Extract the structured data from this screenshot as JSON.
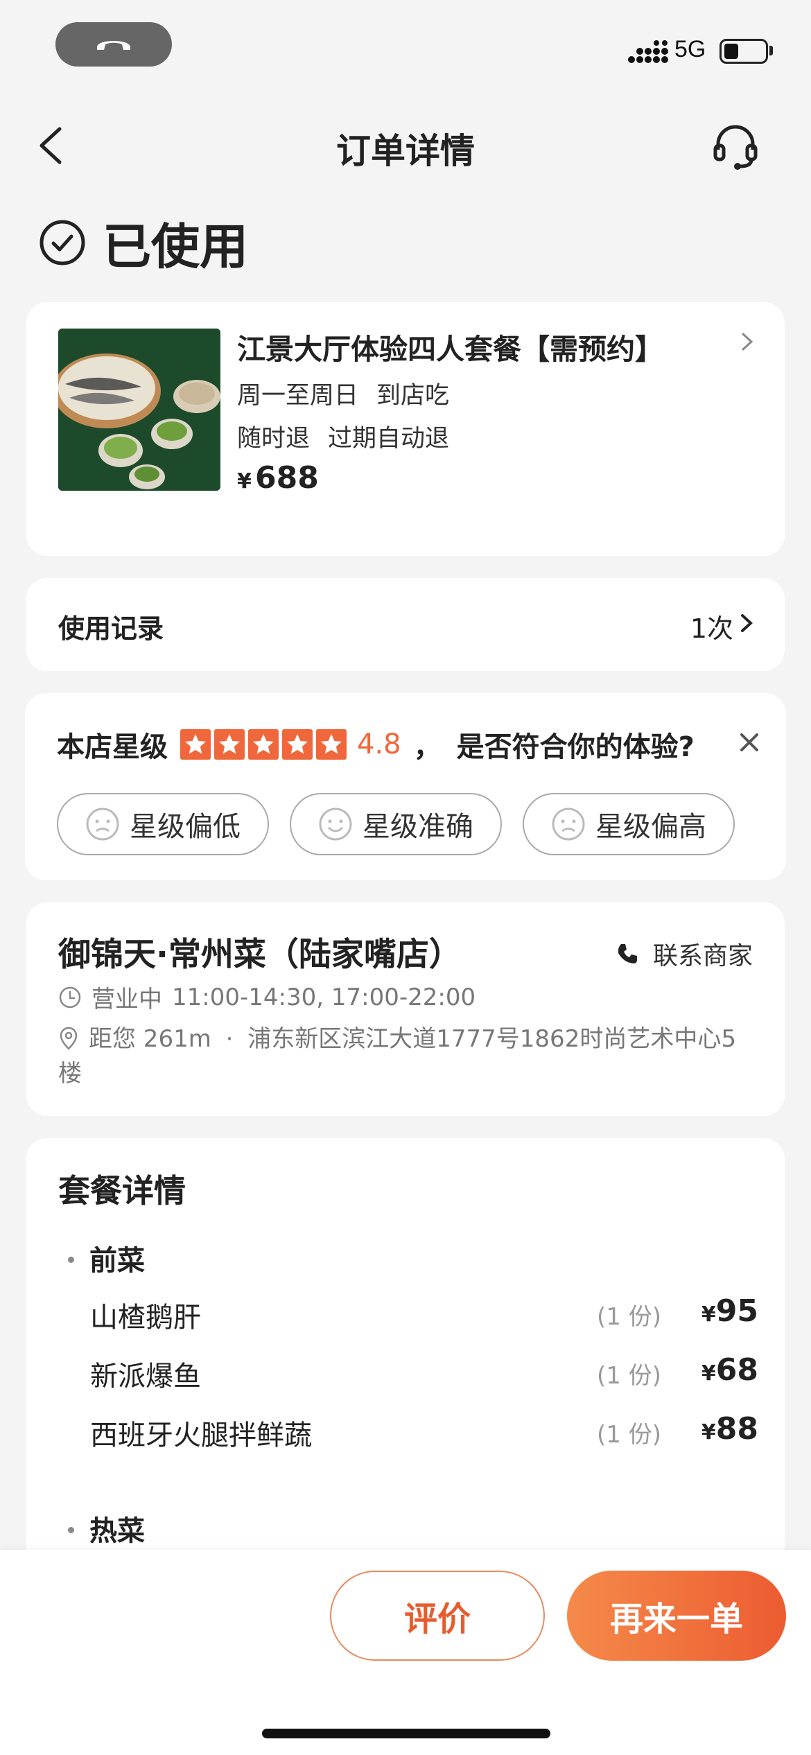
{
  "status_bar": {
    "network": "5G",
    "battery_icon": "battery-icon",
    "signal_icon": "signal-icon"
  },
  "nav": {
    "title": "订单详情",
    "back_icon": "back-chevron-icon",
    "support_icon": "headset-icon"
  },
  "order": {
    "status": "已使用"
  },
  "product": {
    "title": "江景大厅体验四人套餐【需预约】",
    "tags1": [
      "周一至周日",
      "到店吃"
    ],
    "tags2": [
      "随时退",
      "过期自动退"
    ],
    "currency": "¥",
    "price": "688"
  },
  "usage": {
    "label": "使用记录",
    "count": "1次"
  },
  "rating": {
    "label": "本店星级",
    "stars": 5,
    "score": "4.8",
    "separator": "，",
    "question": "是否符合你的体验?",
    "options": [
      "星级偏低",
      "星级准确",
      "星级偏高"
    ],
    "accent_color": "#f0673b"
  },
  "store": {
    "name": "御锦天·常州菜（陆家嘴店）",
    "contact_label": "联系商家",
    "status": "营业中",
    "hours": "11:00-14:30, 17:00-22:00",
    "distance": "距您 261m",
    "dot": "·",
    "address": "浦东新区滨江大道1777号1862时尚艺术中心5楼"
  },
  "package": {
    "title": "套餐详情",
    "sections": [
      {
        "name": "前菜",
        "items": [
          {
            "name": "山楂鹅肝",
            "qty": "(1 份)",
            "currency": "¥",
            "price": "95"
          },
          {
            "name": "新派爆鱼",
            "qty": "(1 份)",
            "currency": "¥",
            "price": "68"
          },
          {
            "name": "西班牙火腿拌鲜蔬",
            "qty": "(1 份)",
            "currency": "¥",
            "price": "88"
          }
        ]
      },
      {
        "name": "热菜",
        "items": []
      }
    ]
  },
  "actions": {
    "review": "评价",
    "reorder": "再来一单"
  }
}
